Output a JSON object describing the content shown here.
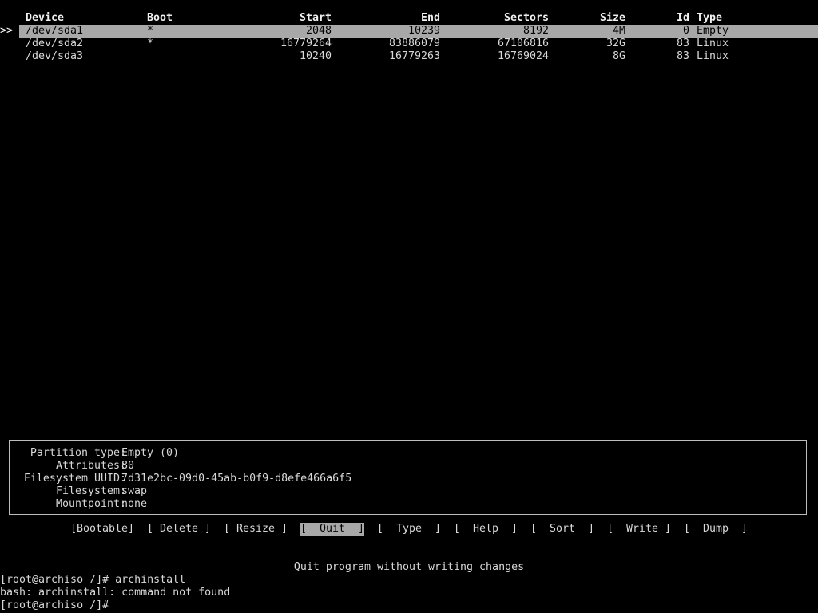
{
  "table": {
    "headers": {
      "device": "Device",
      "boot": "Boot",
      "start": "Start",
      "end": "End",
      "sectors": "Sectors",
      "size": "Size",
      "id": "Id",
      "type": "Type"
    },
    "selected_marker": ">>",
    "rows": [
      {
        "device": "/dev/sda1",
        "boot": "*",
        "start": "2048",
        "end": "10239",
        "sectors": "8192",
        "size": "4M",
        "id": "0",
        "type": "Empty"
      },
      {
        "device": "/dev/sda2",
        "boot": "*",
        "start": "16779264",
        "end": "83886079",
        "sectors": "67106816",
        "size": "32G",
        "id": "83",
        "type": "Linux"
      },
      {
        "device": "/dev/sda3",
        "boot": "",
        "start": "10240",
        "end": "16779263",
        "sectors": "16769024",
        "size": "8G",
        "id": "83",
        "type": "Linux"
      }
    ]
  },
  "info": {
    "partition_type_label": "Partition type:",
    "partition_type_value": "Empty (0)",
    "attributes_label": "Attributes:",
    "attributes_value": "80",
    "uuid_label": "Filesystem UUID:",
    "uuid_value": "7d31e2bc-09d0-45ab-b0f9-d8efe466a6f5",
    "filesystem_label": "Filesystem:",
    "filesystem_value": "swap",
    "mountpoint_label": "Mountpoint:",
    "mountpoint_value": "none"
  },
  "menu": {
    "bootable": "[Bootable]",
    "delete": "[ Delete ]",
    "resize": "[ Resize ]",
    "quit": "[  Quit  ]",
    "type": "[  Type  ]",
    "help": "[  Help  ]",
    "sort": "[  Sort  ]",
    "write": "[  Write ]",
    "dump": "[  Dump  ]",
    "active": "quit"
  },
  "hint": "Quit program without writing changes",
  "terminal": {
    "line1": "[root@archiso /]# archinstall",
    "line2": "bash: archinstall: command not found",
    "line3": "[root@archiso /]#"
  },
  "colors": {
    "background": "#000000",
    "text": "#d8d8d8",
    "selection": "#a8a8a8"
  }
}
